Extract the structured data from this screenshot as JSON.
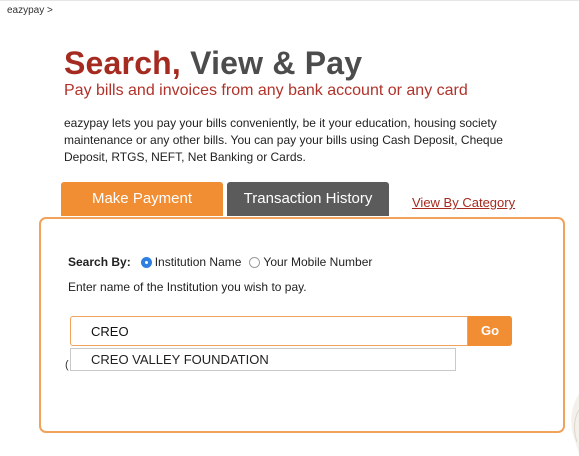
{
  "breadcrumb": "eazypay >",
  "hero": {
    "title_red": "Search,",
    "title_grey": "View & Pay",
    "subtitle": "Pay bills and invoices from any bank account or any card"
  },
  "intro": "eazypay lets you pay your bills conveniently, be it your education, housing society maintenance or any other bills. You can pay your bills using Cash Deposit, Cheque Deposit, RTGS, NEFT, Net Banking or Cards.",
  "tabs": {
    "make_payment": "Make Payment",
    "transaction_history": "Transaction History",
    "view_by_category": "View By Category"
  },
  "search": {
    "search_by_label": "Search By:",
    "options": [
      {
        "label": "Institution Name",
        "selected": true
      },
      {
        "label": "Your Mobile Number",
        "selected": false
      }
    ],
    "hint": "Enter name of the Institution you wish to pay.",
    "input_value": "CREO",
    "go_label": "Go",
    "suggestions": [
      "CREO VALLEY FOUNDATION"
    ]
  },
  "colors": {
    "accent_orange": "#f18d32",
    "brand_red": "#a52a1f",
    "tab_grey": "#5b5b5b",
    "radio_blue": "#2f7fe0"
  }
}
